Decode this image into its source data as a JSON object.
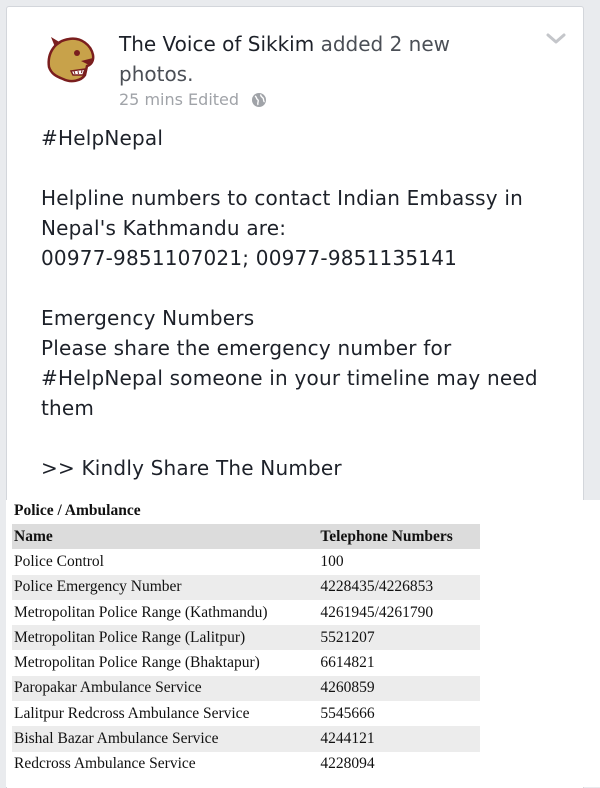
{
  "post": {
    "author": "The Voice of Sikkim",
    "action": " added 2 new photos.",
    "time": "25 mins",
    "edited": "Edited",
    "lines": [
      "#HelpNepal",
      "",
      "Helpline numbers to contact Indian Embassy in Nepal's Kathmandu are:",
      "00977-9851107021; 00977-9851135141",
      "",
      "Emergency Numbers",
      "Please share the emergency number for #HelpNepal someone in your timeline may need them",
      "",
      ">> Kindly Share The Number"
    ]
  },
  "icons": {
    "avatar": "cougar-logo-icon",
    "privacy": "globe-icon",
    "menu": "chevron-down-icon"
  },
  "colors": {
    "author": "#1d2129",
    "meta": "#a0a3a8",
    "table_header_bg": "#dcdcdc",
    "table_alt_bg": "#ececec",
    "logo_gold": "#c8a24a",
    "logo_maroon": "#7a1e1e"
  },
  "table": {
    "title": "Police / Ambulance",
    "columns": [
      "Name",
      "Telephone Numbers"
    ],
    "rows": [
      [
        "Police Control",
        "100"
      ],
      [
        "Police Emergency Number",
        "4228435/4226853"
      ],
      [
        "Metropolitan Police Range (Kathmandu)",
        "4261945/4261790"
      ],
      [
        "Metropolitan Police Range (Lalitpur)",
        "5521207"
      ],
      [
        "Metropolitan Police Range (Bhaktapur)",
        "6614821"
      ],
      [
        "Paropakar Ambulance Service",
        "4260859"
      ],
      [
        "Lalitpur Redcross Ambulance Service",
        "5545666"
      ],
      [
        "Bishal Bazar Ambulance Service",
        "4244121"
      ],
      [
        "Redcross Ambulance Service",
        "4228094"
      ]
    ]
  }
}
